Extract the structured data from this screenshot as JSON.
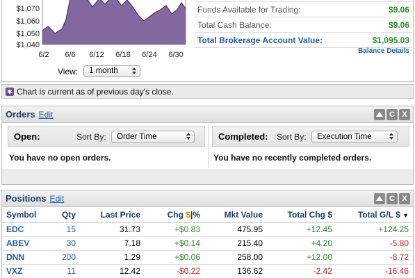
{
  "chart": {
    "y_ticks": [
      "$1,070",
      "$1,060",
      "$1,050",
      "$1,040"
    ],
    "x_ticks": [
      "6/2",
      "6/6",
      "6/12",
      "6/18",
      "6/24",
      "6/30"
    ],
    "fill_color": "#6d4d8f",
    "view_label": "View:",
    "view_value": "1 month"
  },
  "summary": {
    "rows": [
      {
        "label": "Funds Available for Trading:",
        "value": "$9.06"
      },
      {
        "label": "Total Cash Balance:",
        "value": "$9.06"
      },
      {
        "label": "Total Brokerage Account Value:",
        "value": "$1,095.03"
      }
    ],
    "balance_details": "Balance Details"
  },
  "info_bar": {
    "icon": "info-icon",
    "text": "Chart is current as of previous day's close."
  },
  "orders": {
    "title": "Orders",
    "edit": "Edit",
    "open": {
      "title": "Open:",
      "sort_label": "Sort By:",
      "sort_value": "Order Time",
      "empty": "You have no open orders."
    },
    "completed": {
      "title": "Completed:",
      "sort_label": "Sort By:",
      "sort_value": "Execution Time",
      "empty": "You have no recently completed orders."
    },
    "controls": [
      "collapse-icon",
      "refresh-icon",
      "close-icon"
    ],
    "control_labels": [
      "",
      "C",
      "X"
    ]
  },
  "positions": {
    "title": "Positions",
    "edit": "Edit",
    "control_labels": [
      "",
      "C",
      "X"
    ],
    "columns": {
      "symbol": "Symbol",
      "qty": "Qty",
      "last_price": "Last Price",
      "chg": "Chg",
      "chg_dollar": "$",
      "chg_sep": "|",
      "chg_pct": "%",
      "mkt_value": "Mkt Value",
      "total_chg": "Total Chg $",
      "total_gl": "Total G/L $",
      "sort_indicator": "▼"
    },
    "rows": [
      {
        "symbol": "EDC",
        "qty": "15",
        "last_price": "31.73",
        "chg": "+$0.83",
        "mkt_value": "475.95",
        "total_chg": "+12.45",
        "total_gl": "+124.25"
      },
      {
        "symbol": "ABEV",
        "qty": "30",
        "last_price": "7.18",
        "chg": "+$0.14",
        "mkt_value": "215.40",
        "total_chg": "+4.20",
        "total_gl": "-5.80"
      },
      {
        "symbol": "DNN",
        "qty": "200",
        "last_price": "1.29",
        "chg": "+$0.06",
        "mkt_value": "258.00",
        "total_chg": "+12.00",
        "total_gl": "-8.72"
      },
      {
        "symbol": "VXZ",
        "qty": "11",
        "last_price": "12.42",
        "chg": "-$0.22",
        "mkt_value": "136.62",
        "total_chg": "-2.42",
        "total_gl": "-16.46"
      }
    ]
  }
}
